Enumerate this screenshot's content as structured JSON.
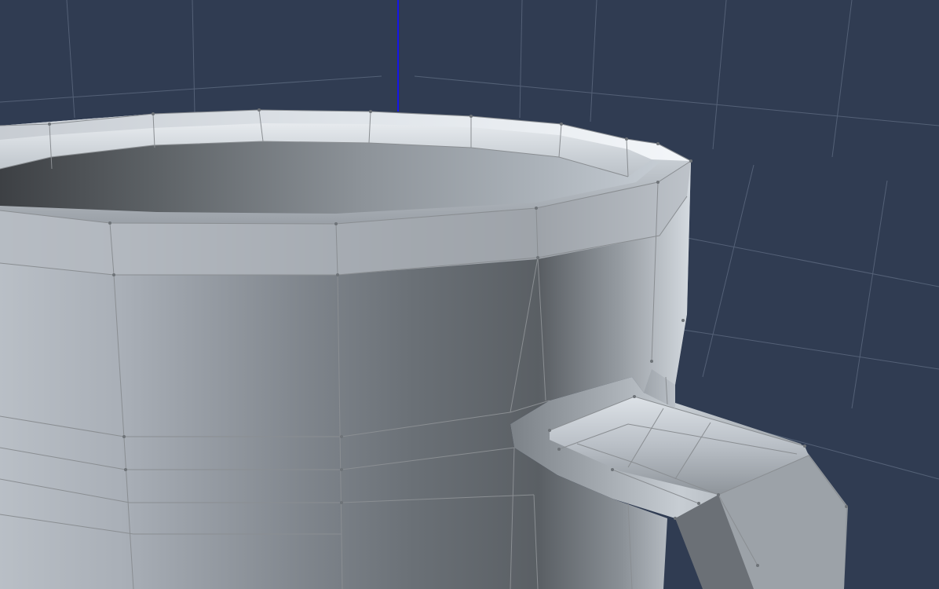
{
  "viewport": {
    "label": "",
    "background_color": "#303c52",
    "grid_color": "#5d6a80",
    "axis_color": "#1616e6",
    "wireframe_color": "#8a8e92",
    "vertex_color": "#6e7378"
  },
  "scene": {
    "object": "mug-mesh",
    "display_mode": "shaded-with-wireframe",
    "visible_parts": [
      "mug-body",
      "mug-rim",
      "mug-interior",
      "mug-handle"
    ]
  }
}
